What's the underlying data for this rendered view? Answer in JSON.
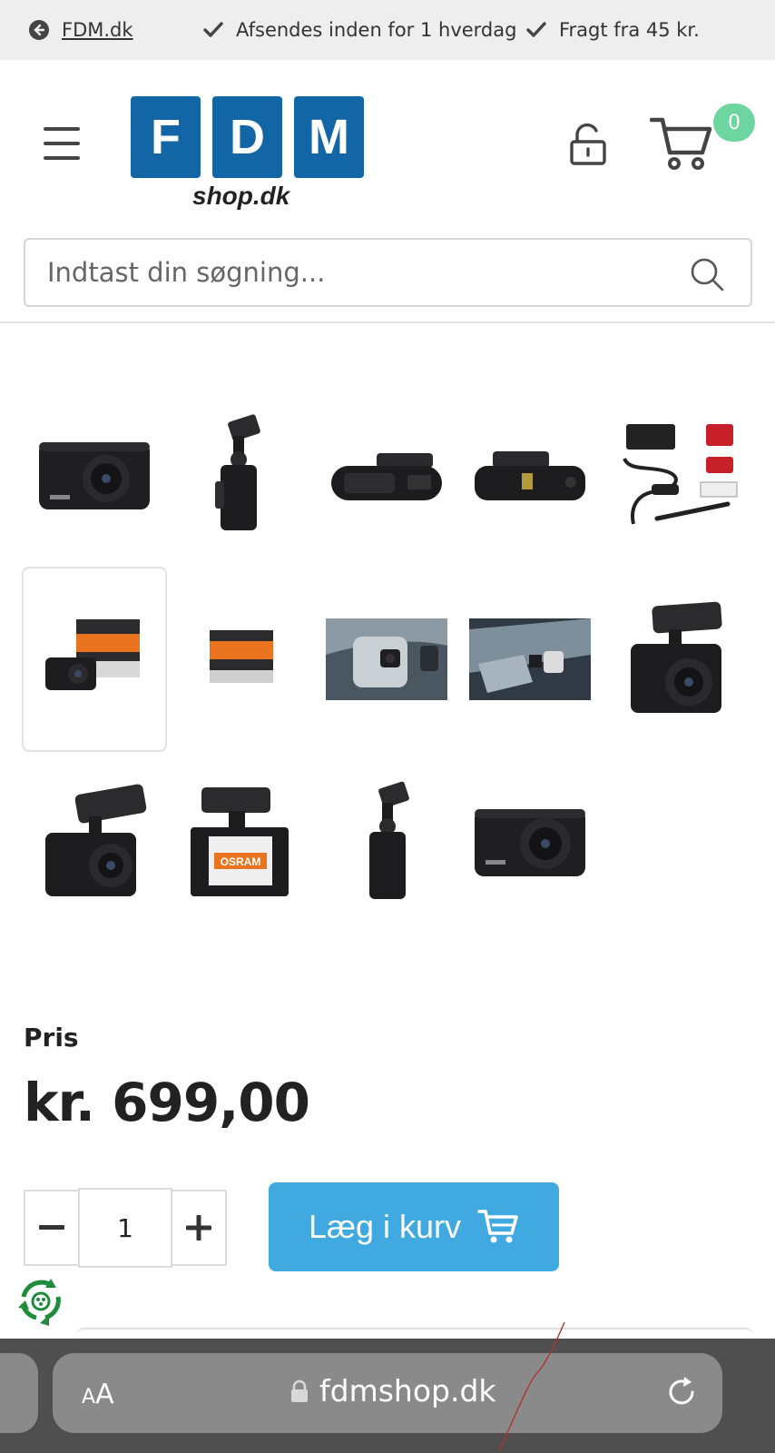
{
  "topbar": {
    "back_label": "FDM.dk",
    "shipping_label": "Afsendes inden for 1 hverdag",
    "freight_label": "Fragt fra 45 kr."
  },
  "header": {
    "logo_letters": [
      "F",
      "D",
      "M"
    ],
    "logo_sub": "shop.dk",
    "cart_count": "0"
  },
  "search": {
    "placeholder": "Indtast din søgning..."
  },
  "gallery": {
    "thumbnails": [
      {
        "name": "dashcam-front"
      },
      {
        "name": "dashcam-side"
      },
      {
        "name": "dashcam-top"
      },
      {
        "name": "dashcam-bottom"
      },
      {
        "name": "accessories-kit"
      },
      {
        "name": "box-with-camera"
      },
      {
        "name": "box"
      },
      {
        "name": "mounted-interior-1"
      },
      {
        "name": "mounted-interior-2"
      },
      {
        "name": "dashcam-with-mount"
      },
      {
        "name": "dashcam-angle"
      },
      {
        "name": "dashcam-screen"
      },
      {
        "name": "dashcam-side-2"
      },
      {
        "name": "dashcam-front-2"
      }
    ],
    "selected_index": 5,
    "screen_brand": "OSRAM"
  },
  "product": {
    "price_label": "Pris",
    "price": "kr. 699,00",
    "quantity": "1",
    "add_to_cart_label": "Læg i kurv"
  },
  "browser": {
    "text_size_label_small": "A",
    "text_size_label_large": "A",
    "domain": "fdmshop.dk"
  },
  "colors": {
    "brand_blue": "#1266a6",
    "button_blue": "#3fa9e0",
    "badge_green": "#6dd5a0",
    "topbar_bg": "#eeeeee"
  }
}
